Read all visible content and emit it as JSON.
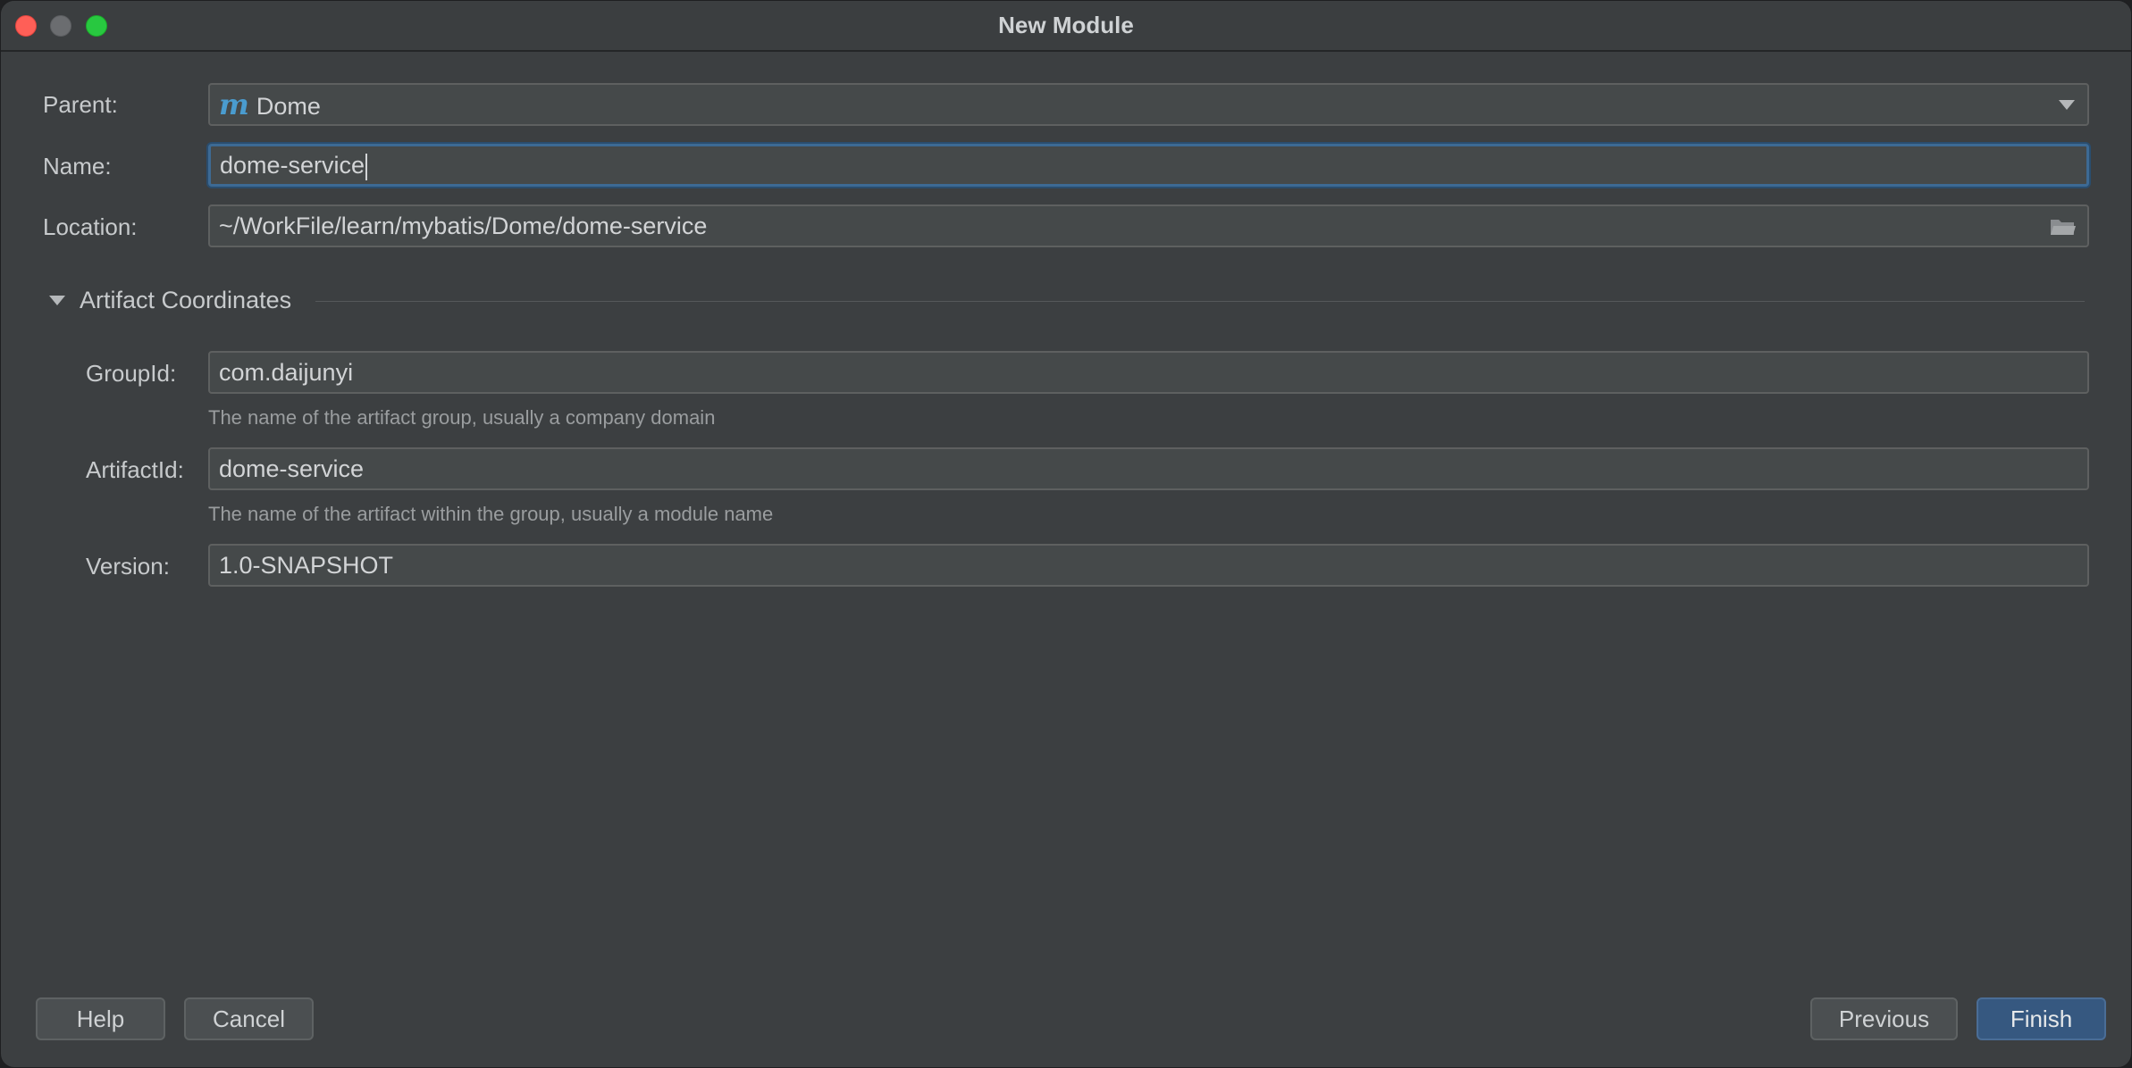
{
  "window": {
    "title": "New Module"
  },
  "form": {
    "parent_label": "Parent:",
    "parent_value": "Dome",
    "parent_icon": "maven-m-icon",
    "name_label": "Name:",
    "name_value": "dome-service",
    "location_label": "Location:",
    "location_value": "~/WorkFile/learn/mybatis/Dome/dome-service"
  },
  "artifact": {
    "section_title": "Artifact Coordinates",
    "group_label": "GroupId:",
    "group_value": "com.daijunyi",
    "group_hint": "The name of the artifact group, usually a company domain",
    "artifact_label": "ArtifactId:",
    "artifact_value": "dome-service",
    "artifact_hint": "The name of the artifact within the group, usually a module name",
    "version_label": "Version:",
    "version_value": "1.0-SNAPSHOT"
  },
  "buttons": {
    "help": "Help",
    "cancel": "Cancel",
    "previous": "Previous",
    "finish": "Finish"
  },
  "colors": {
    "background": "#3c3f41",
    "field": "#45494a",
    "focus": "#3d6a94",
    "primary_button": "#365880"
  }
}
